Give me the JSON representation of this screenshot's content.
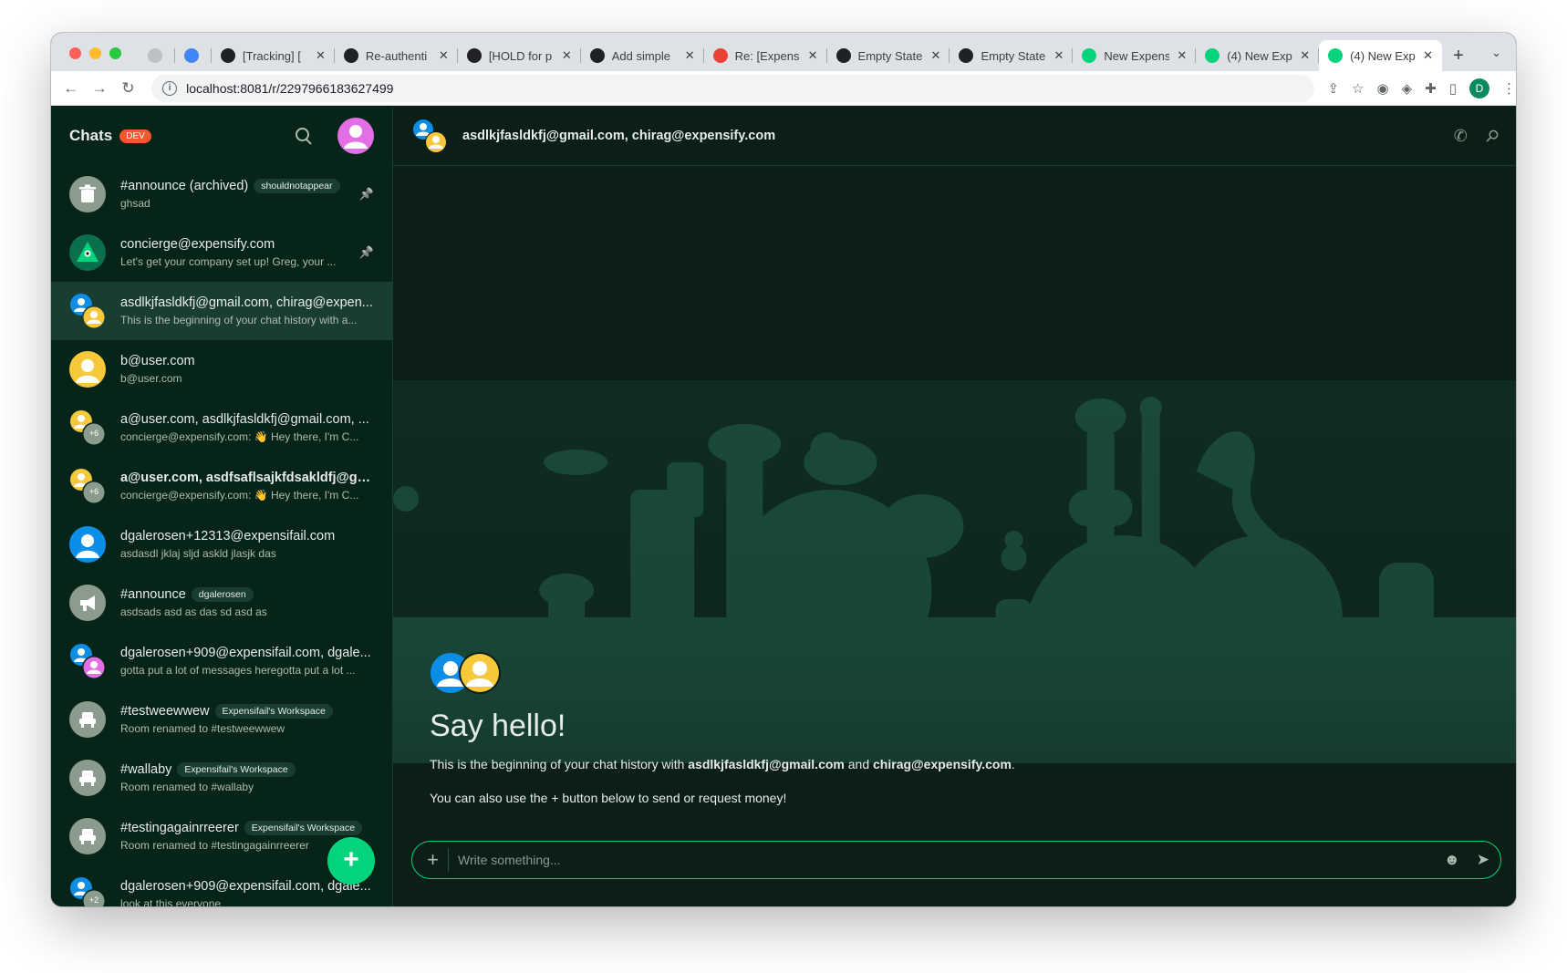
{
  "browser": {
    "tabs": [
      {
        "title": "",
        "favicon": "google-icon",
        "color": "#bdc1c6"
      },
      {
        "title": "",
        "favicon": "calendar-icon",
        "color": "#4285f4"
      },
      {
        "title": "[Tracking] [",
        "favicon": "github-icon",
        "color": "#202124"
      },
      {
        "title": "Re-authenti",
        "favicon": "github-icon",
        "color": "#202124"
      },
      {
        "title": "[HOLD for p",
        "favicon": "github-icon",
        "color": "#202124"
      },
      {
        "title": "Add simple",
        "favicon": "github-icon",
        "color": "#202124"
      },
      {
        "title": "Re: [Expens",
        "favicon": "gmail-icon",
        "color": "#ea4335"
      },
      {
        "title": "Empty State",
        "favicon": "github-icon",
        "color": "#202124"
      },
      {
        "title": "Empty State",
        "favicon": "github-icon",
        "color": "#202124"
      },
      {
        "title": "New Expens",
        "favicon": "expensify-icon",
        "color": "#03d47c"
      },
      {
        "title": "(4) New Exp",
        "favicon": "expensify-icon",
        "color": "#03d47c"
      },
      {
        "title": "(4) New Exp",
        "favicon": "expensify-icon",
        "color": "#03d47c",
        "active": true
      }
    ],
    "url": "localhost:8081/r/2297966183627499",
    "profile_initial": "D"
  },
  "sidebar": {
    "title": "Chats",
    "badge": "DEV",
    "fab_label": "+",
    "items": [
      {
        "name": "#announce (archived)",
        "pill": "shouldnotappear",
        "preview": "ghsad",
        "pinned": true,
        "avatar": "trash",
        "bold": false
      },
      {
        "name": "concierge@expensify.com",
        "pill": "",
        "preview": "Let's get your company set up! Greg, your ...",
        "pinned": true,
        "avatar": "concierge",
        "bold": false
      },
      {
        "name": "asdlkjfasldkfj@gmail.com, chirag@expen...",
        "pill": "",
        "preview": "This is the beginning of your chat history with a...",
        "pinned": false,
        "avatar": "pair-blue-yellow",
        "bold": false,
        "selected": true
      },
      {
        "name": "b@user.com",
        "pill": "",
        "preview": "b@user.com",
        "pinned": false,
        "avatar": "yellow",
        "bold": false
      },
      {
        "name": "a@user.com, asdlkjfasldkfj@gmail.com, ...",
        "pill": "",
        "preview": "concierge@expensify.com: 👋 Hey there, I'm C...",
        "pinned": false,
        "avatar": "yellow-plus6",
        "bold": false,
        "extra": "+6"
      },
      {
        "name": "a@user.com, asdfsaflsajkfdsakldfj@gm...",
        "pill": "",
        "preview": "concierge@expensify.com: 👋 Hey there, I'm C...",
        "pinned": false,
        "avatar": "yellow-plus6",
        "bold": true,
        "extra": "+6"
      },
      {
        "name": "dgalerosen+12313@expensifail.com",
        "pill": "",
        "preview": "asdasdl jklaj sljd askld jlasjk das",
        "pinned": false,
        "avatar": "blue",
        "bold": false
      },
      {
        "name": "#announce",
        "pill": "dgalerosen",
        "preview": "asdsads asd as das sd asd as",
        "pinned": false,
        "avatar": "megaphone",
        "bold": false
      },
      {
        "name": "dgalerosen+909@expensifail.com, dgale...",
        "pill": "",
        "preview": "gotta put a lot of messages heregotta put a lot ...",
        "pinned": false,
        "avatar": "pair-blue-pink",
        "bold": false
      },
      {
        "name": "#testweewwew",
        "pill": "Expensifail's Workspace",
        "preview": "Room renamed to #testweewwew",
        "pinned": false,
        "avatar": "room",
        "bold": false
      },
      {
        "name": "#wallaby",
        "pill": "Expensifail's Workspace",
        "preview": "Room renamed to #wallaby",
        "pinned": false,
        "avatar": "room",
        "bold": false
      },
      {
        "name": "#testingagainrreerer",
        "pill": "Expensifail's Workspace",
        "preview": "Room renamed to #testingagainrreerer",
        "pinned": false,
        "avatar": "room",
        "bold": false
      },
      {
        "name": "dgalerosen+909@expensifail.com, dgale...",
        "pill": "",
        "preview": "look at this everyone",
        "pinned": false,
        "avatar": "blue-plus2",
        "bold": false,
        "extra": "+2"
      }
    ]
  },
  "chat": {
    "title": "asdlkjfasldkfj@gmail.com, chirag@expensify.com",
    "welcome_title": "Say hello!",
    "welcome_prefix": "This is the beginning of your chat history with ",
    "welcome_user1": "asdlkjfasldkfj@gmail.com",
    "welcome_and": " and ",
    "welcome_user2": "chirag@expensify.com",
    "welcome_suffix": ".",
    "welcome_hint": "You can also use the + button below to send or request money!",
    "composer_placeholder": "Write something..."
  },
  "colors": {
    "accent": "#03d47c",
    "sidebar_bg": "#072419",
    "main_bg": "#0b1e17",
    "badge": "#f25730"
  }
}
